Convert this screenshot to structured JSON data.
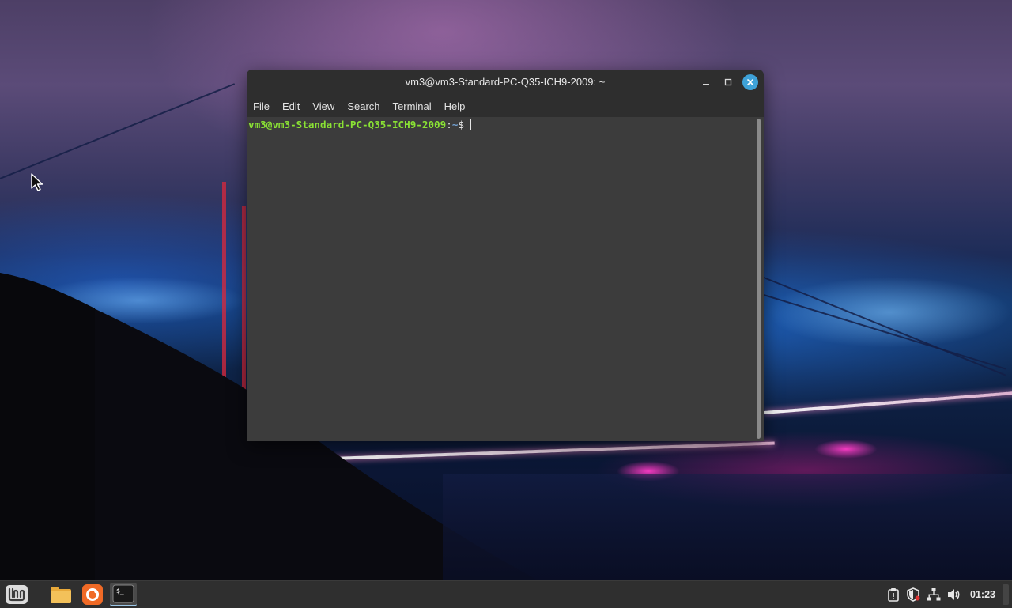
{
  "window": {
    "title": "vm3@vm3-Standard-PC-Q35-ICH9-2009: ~",
    "minimize_label": "–",
    "maximize_label": "□",
    "close_label": "✕"
  },
  "menubar": {
    "items": [
      "File",
      "Edit",
      "View",
      "Search",
      "Terminal",
      "Help"
    ]
  },
  "terminal": {
    "prompt_userhost": "vm3@vm3-Standard-PC-Q35-ICH9-2009",
    "prompt_sep": ":",
    "prompt_path": "~",
    "prompt_symbol": "$ "
  },
  "taskbar": {
    "apps": [
      {
        "name": "linux-mint-menu",
        "icon": "mint-logo-icon"
      },
      {
        "name": "files",
        "icon": "folder-icon"
      },
      {
        "name": "firefox",
        "icon": "firefox-icon"
      },
      {
        "name": "terminal",
        "icon": "terminal-icon",
        "active": true
      }
    ],
    "tray": [
      "clipboard-icon",
      "shield-icon",
      "network-icon",
      "volume-icon"
    ],
    "clock": "01:23"
  },
  "colors": {
    "prompt_green": "#8ae234",
    "prompt_blue": "#729fcf",
    "close_button": "#3ea2d8",
    "terminal_bg": "#3c3c3c",
    "titlebar_bg": "#2e2e2e",
    "taskbar_bg": "#2f2f2f"
  }
}
